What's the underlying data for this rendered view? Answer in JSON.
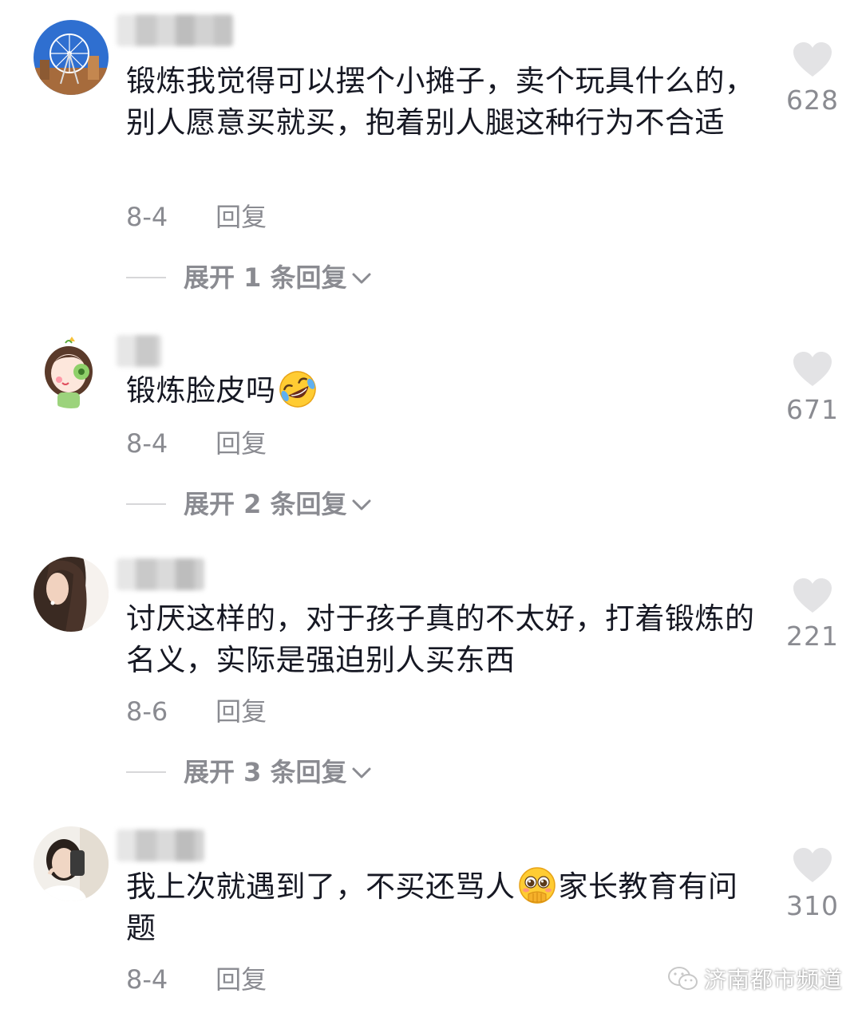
{
  "comments": [
    {
      "text": "锻炼我觉得可以摆个小摊子，卖个玩具什么的，别人愿意买就买，抱着别人腿这种行为不合适",
      "date": "8-4",
      "reply_label": "回复",
      "expand_label": "展开 1 条回复",
      "likes": "628",
      "avatar": "ferris-wheel"
    },
    {
      "text": "锻炼脸皮吗",
      "emoji": "rofl-emoji",
      "date": "8-4",
      "reply_label": "回复",
      "expand_label": "展开 2 条回复",
      "likes": "671",
      "avatar": "cartoon-girl"
    },
    {
      "text": "讨厌这样的，对于孩子真的不太好，打着锻炼的名义，实际是强迫别人买东西",
      "date": "8-6",
      "reply_label": "回复",
      "expand_label": "展开 3 条回复",
      "likes": "221",
      "avatar": "woman-profile"
    },
    {
      "text_before": "我上次就遇到了，不买还骂人",
      "emoji": "pleading-face-emoji",
      "text_after": "家长教育有问题",
      "date": "8-4",
      "reply_label": "回复",
      "likes": "310",
      "avatar": "woman-selfie"
    }
  ],
  "watermark": "济南都市频道",
  "colors": {
    "text": "#161823",
    "secondary": "#8a8b91",
    "heart": "#e3e3e5"
  }
}
